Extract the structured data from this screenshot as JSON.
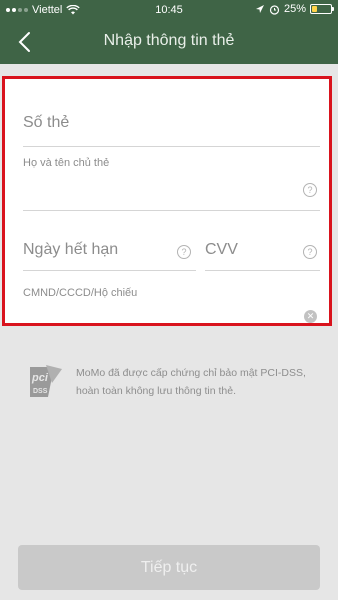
{
  "status_bar": {
    "carrier": "Viettel",
    "time": "10:45",
    "battery_percent": "25%",
    "battery_level": 0.25
  },
  "header": {
    "title": "Nhập thông tin thẻ",
    "back_icon": "chevron-left-icon"
  },
  "form": {
    "card_number": {
      "placeholder": "Số thẻ",
      "value": ""
    },
    "cardholder_name": {
      "label": "Họ và tên chủ thẻ",
      "value": ""
    },
    "expiry_date": {
      "placeholder": "Ngày hết hạn",
      "value": ""
    },
    "cvv": {
      "placeholder": "CVV",
      "value": ""
    },
    "id_number": {
      "label": "CMND/CCCD/Hộ chiếu",
      "value": ""
    },
    "highlight_color": "#d9131d"
  },
  "security_note": {
    "logo_text_top": "pci",
    "logo_text_bottom": "DSS",
    "text": "MoMo đã được cấp chứng chỉ bảo mật PCI-DSS, hoàn toàn không lưu thông tin thẻ."
  },
  "actions": {
    "continue_label": "Tiếp tục"
  },
  "colors": {
    "header_bg": "#3f6446",
    "button_disabled": "#c9c9c9"
  }
}
